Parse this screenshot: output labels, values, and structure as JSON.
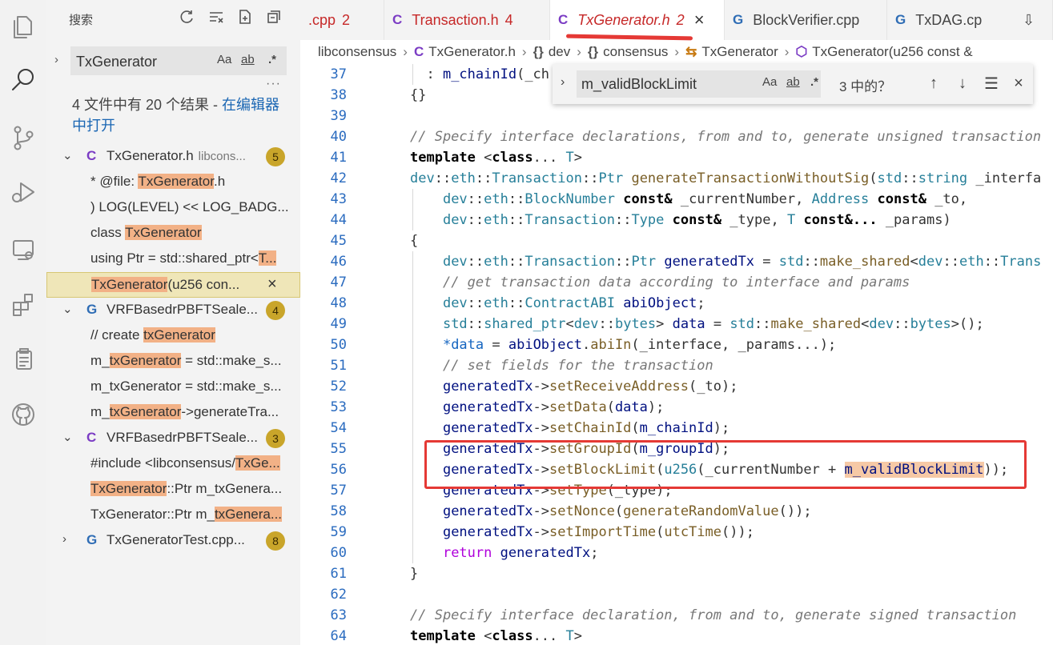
{
  "sidebar": {
    "title": "搜索",
    "search_value": "TxGenerator",
    "opt_case": "Aa",
    "opt_word": "ab",
    "opt_regex": ".*",
    "more": "···",
    "summary_text": "4 文件中有 20 个结果 - ",
    "summary_link": "在编辑器中打开",
    "results": [
      {
        "type": "file",
        "icon": "C",
        "icon_color": "#7b3cc4",
        "name": "TxGenerator.h",
        "path": "libcons...",
        "badge": "5",
        "expanded": true
      },
      {
        "type": "match",
        "pre": "* @file: ",
        "hl": "TxGenerator",
        "post": ".h"
      },
      {
        "type": "match",
        "pre": ") LOG(LEVEL) << LOG_BADG...",
        "hl": "",
        "post": ""
      },
      {
        "type": "match",
        "pre": "class ",
        "hl": "TxGenerator",
        "post": ""
      },
      {
        "type": "match",
        "pre": "using Ptr = std::shared_ptr<",
        "hl": "T...",
        "post": ""
      },
      {
        "type": "match",
        "pre": "",
        "hl": "TxGenerator",
        "post": "(u256 con...",
        "selected": true,
        "close": "×"
      },
      {
        "type": "file",
        "icon": "G",
        "icon_color": "#2f6db5",
        "name": "VRFBasedrPBFTSeale...",
        "path": "",
        "badge": "4",
        "expanded": true
      },
      {
        "type": "match",
        "pre": "// create ",
        "hl": "txGenerator",
        "post": ""
      },
      {
        "type": "match",
        "pre": "m_",
        "hl": "txGenerator",
        "post": " = std::make_s..."
      },
      {
        "type": "match",
        "pre": "m_txGenerator = std::make_s...",
        "hl": "",
        "post": ""
      },
      {
        "type": "match",
        "pre": "m_",
        "hl": "txGenerator",
        "post": "->generateTra..."
      },
      {
        "type": "file",
        "icon": "C",
        "icon_color": "#7b3cc4",
        "name": "VRFBasedrPBFTSeale...",
        "path": "",
        "badge": "3",
        "expanded": true
      },
      {
        "type": "match",
        "pre": "#include <libconsensus/",
        "hl": "TxGe...",
        "post": ""
      },
      {
        "type": "match",
        "pre": "",
        "hl": "TxGenerator",
        "post": "::Ptr m_txGenera..."
      },
      {
        "type": "match",
        "pre": "TxGenerator::Ptr m_",
        "hl": "txGenera...",
        "post": ""
      },
      {
        "type": "file",
        "icon": "G",
        "icon_color": "#2f6db5",
        "name": "TxGeneratorTest.cpp...",
        "path": "",
        "badge": "8",
        "expanded": false
      }
    ]
  },
  "tabs": [
    {
      "icon": "",
      "name": ".cpp",
      "count": "2",
      "red": true
    },
    {
      "icon": "C",
      "name": "Transaction.h",
      "count": "4",
      "red": true
    },
    {
      "icon": "C",
      "name": "TxGenerator.h",
      "count": "2",
      "red": true,
      "active": true,
      "close": "×"
    },
    {
      "icon": "G",
      "name": "BlockVerifier.cpp",
      "count": "",
      "red": false
    },
    {
      "icon": "G",
      "name": "TxDAG.cp",
      "count": "",
      "red": false
    }
  ],
  "breadcrumb": [
    "libconsensus",
    "TxGenerator.h",
    "dev",
    "consensus",
    "TxGenerator",
    "TxGenerator(u256 const &"
  ],
  "find": {
    "value": "m_validBlockLimit",
    "opt_case": "Aa",
    "opt_word": "ab",
    "opt_regex": ".*",
    "count": "3 中的？",
    "up": "↑",
    "down": "↓",
    "close": "×"
  },
  "editor": {
    "lines": [
      37,
      38,
      39,
      40,
      41,
      42,
      43,
      44,
      45,
      46,
      47,
      48,
      49,
      50,
      51,
      52,
      53,
      54,
      55,
      56,
      57,
      58,
      59,
      60,
      61,
      62,
      63,
      64
    ]
  }
}
